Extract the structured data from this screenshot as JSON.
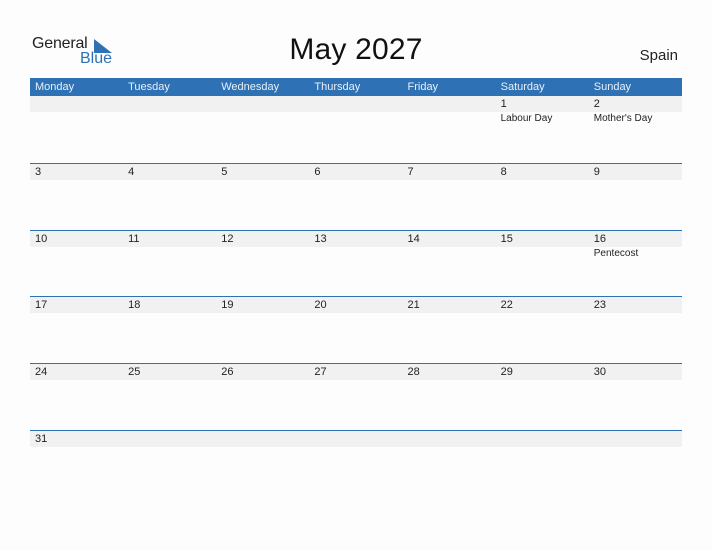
{
  "brand": {
    "line1": "General",
    "line2": "Blue",
    "accent": "#2e72b5"
  },
  "title": "May 2027",
  "country": "Spain",
  "weekdays": [
    "Monday",
    "Tuesday",
    "Wednesday",
    "Thursday",
    "Friday",
    "Saturday",
    "Sunday"
  ],
  "weeks": [
    [
      {
        "day": ""
      },
      {
        "day": ""
      },
      {
        "day": ""
      },
      {
        "day": ""
      },
      {
        "day": ""
      },
      {
        "day": "1",
        "holiday": "Labour Day"
      },
      {
        "day": "2",
        "holiday": "Mother's Day"
      }
    ],
    [
      {
        "day": "3"
      },
      {
        "day": "4"
      },
      {
        "day": "5"
      },
      {
        "day": "6"
      },
      {
        "day": "7"
      },
      {
        "day": "8"
      },
      {
        "day": "9"
      }
    ],
    [
      {
        "day": "10"
      },
      {
        "day": "11"
      },
      {
        "day": "12"
      },
      {
        "day": "13"
      },
      {
        "day": "14"
      },
      {
        "day": "15"
      },
      {
        "day": "16",
        "holiday": "Pentecost"
      }
    ],
    [
      {
        "day": "17"
      },
      {
        "day": "18"
      },
      {
        "day": "19"
      },
      {
        "day": "20"
      },
      {
        "day": "21"
      },
      {
        "day": "22"
      },
      {
        "day": "23"
      }
    ],
    [
      {
        "day": "24"
      },
      {
        "day": "25"
      },
      {
        "day": "26"
      },
      {
        "day": "27"
      },
      {
        "day": "28"
      },
      {
        "day": "29"
      },
      {
        "day": "30"
      }
    ],
    [
      {
        "day": "31"
      },
      {
        "day": ""
      },
      {
        "day": ""
      },
      {
        "day": ""
      },
      {
        "day": ""
      },
      {
        "day": ""
      },
      {
        "day": ""
      }
    ]
  ]
}
